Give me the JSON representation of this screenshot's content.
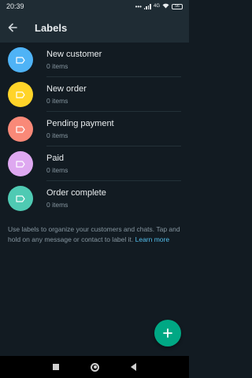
{
  "status_bar": {
    "time": "20:39",
    "dots": "•••",
    "network": "4G",
    "battery": "56"
  },
  "app_bar": {
    "title": "Labels",
    "back_icon": "arrow-left-icon"
  },
  "labels": [
    {
      "name": "New customer",
      "count": "0 items",
      "color": "#4fb3f6"
    },
    {
      "name": "New order",
      "count": "0 items",
      "color": "#ffd429"
    },
    {
      "name": "Pending payment",
      "count": "0 items",
      "color": "#f98978"
    },
    {
      "name": "Paid",
      "count": "0 items",
      "color": "#dea8f0"
    },
    {
      "name": "Order complete",
      "count": "0 items",
      "color": "#4fcab3"
    }
  ],
  "help": {
    "text": "Use labels to organize your customers and chats. Tap and hold on any message or contact to label it.",
    "link": "Learn more"
  },
  "fab": {
    "icon": "plus-icon",
    "color": "#00a884"
  },
  "nav_bar": {
    "icons": [
      "recents-icon",
      "home-icon",
      "back-icon"
    ]
  }
}
